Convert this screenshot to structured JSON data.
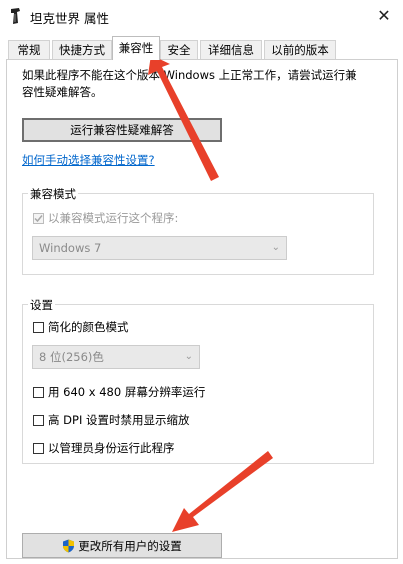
{
  "window": {
    "title": "坦克世界 属性",
    "close_glyph": "✕"
  },
  "tabs": [
    {
      "label": "常规",
      "active": false
    },
    {
      "label": "快捷方式",
      "active": false
    },
    {
      "label": "兼容性",
      "active": true
    },
    {
      "label": "安全",
      "active": false
    },
    {
      "label": "详细信息",
      "active": false
    },
    {
      "label": "以前的版本",
      "active": false
    }
  ],
  "compat": {
    "intro_line1": "如果此程序不能在这个版本 Windows 上正常工作，请尝试运行兼",
    "intro_line2": "容性疑难解答。",
    "troubleshoot_button": "运行兼容性疑难解答",
    "manual_link": "如何手动选择兼容性设置?",
    "mode_group": {
      "label": "兼容模式",
      "checkbox_label": "以兼容模式运行这个程序:",
      "checked": true,
      "os_select": "Windows 7"
    },
    "settings_group": {
      "label": "设置",
      "reduced_color": "简化的颜色模式",
      "color_select": "8 位(256)色",
      "resolution_640": "用 640 x 480 屏幕分辨率运行",
      "high_dpi": "高 DPI 设置时禁用显示缩放",
      "run_as_admin": "以管理员身份运行此程序"
    },
    "all_users_button": "更改所有用户的设置"
  },
  "colors": {
    "annotation_arrow": "#e8402a",
    "link": "#0066cc",
    "shield_blue": "#1c64c8",
    "shield_yellow": "#f2c200"
  }
}
